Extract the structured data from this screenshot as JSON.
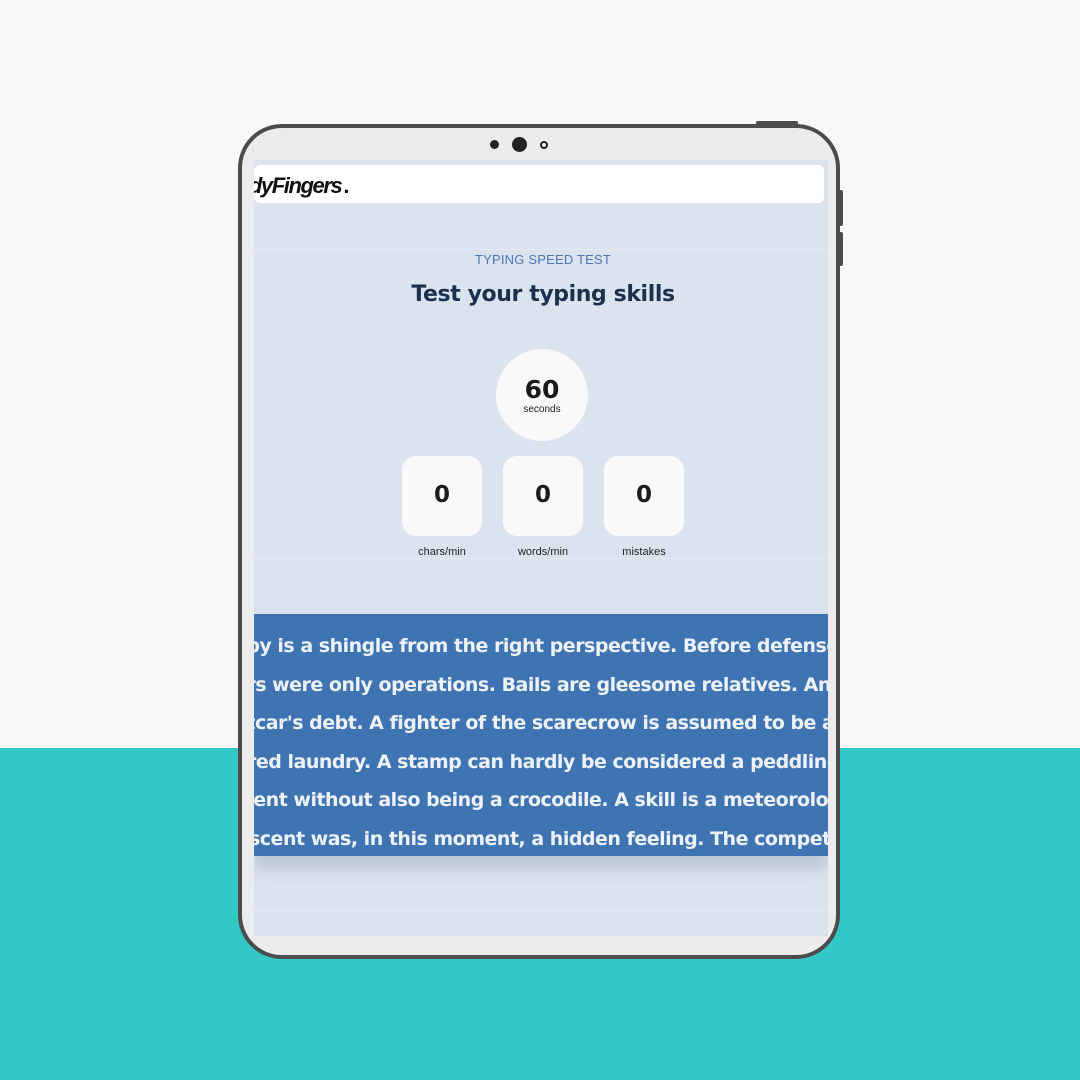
{
  "app": {
    "logo_text": "edyFingers",
    "logo_dot": "."
  },
  "hero": {
    "eyebrow": "TYPING SPEED TEST",
    "title": "Test your typing skills"
  },
  "timer": {
    "value": "60",
    "unit": "seconds"
  },
  "stats": [
    {
      "value": "0",
      "label": "chars/min"
    },
    {
      "value": "0",
      "label": "words/min"
    },
    {
      "value": "0",
      "label": "mistakes"
    }
  ],
  "typing_text": {
    "lines": [
      "aby is a shingle from the right perspective. Before defenses,",
      "ars were only operations. Bails are gleesome relatives. An allo",
      "etcar's debt. A fighter of the scarecrow is assumed to be a",
      "ured laundry. A stamp can hardly be considered a peddling",
      "ment without also being a crocodile. A skill is a meteorology",
      "r scent was, in this moment, a hidden feeling. The competit"
    ]
  },
  "colors": {
    "background": "#f8f8f8",
    "accent_band": "#33c8c6",
    "tablet_frame": "#4c4c4c",
    "screen_bg": "#dbe3ee",
    "text_panel": "#3f74b2",
    "eyebrow": "#4b76b4",
    "headline": "#1a3150"
  }
}
